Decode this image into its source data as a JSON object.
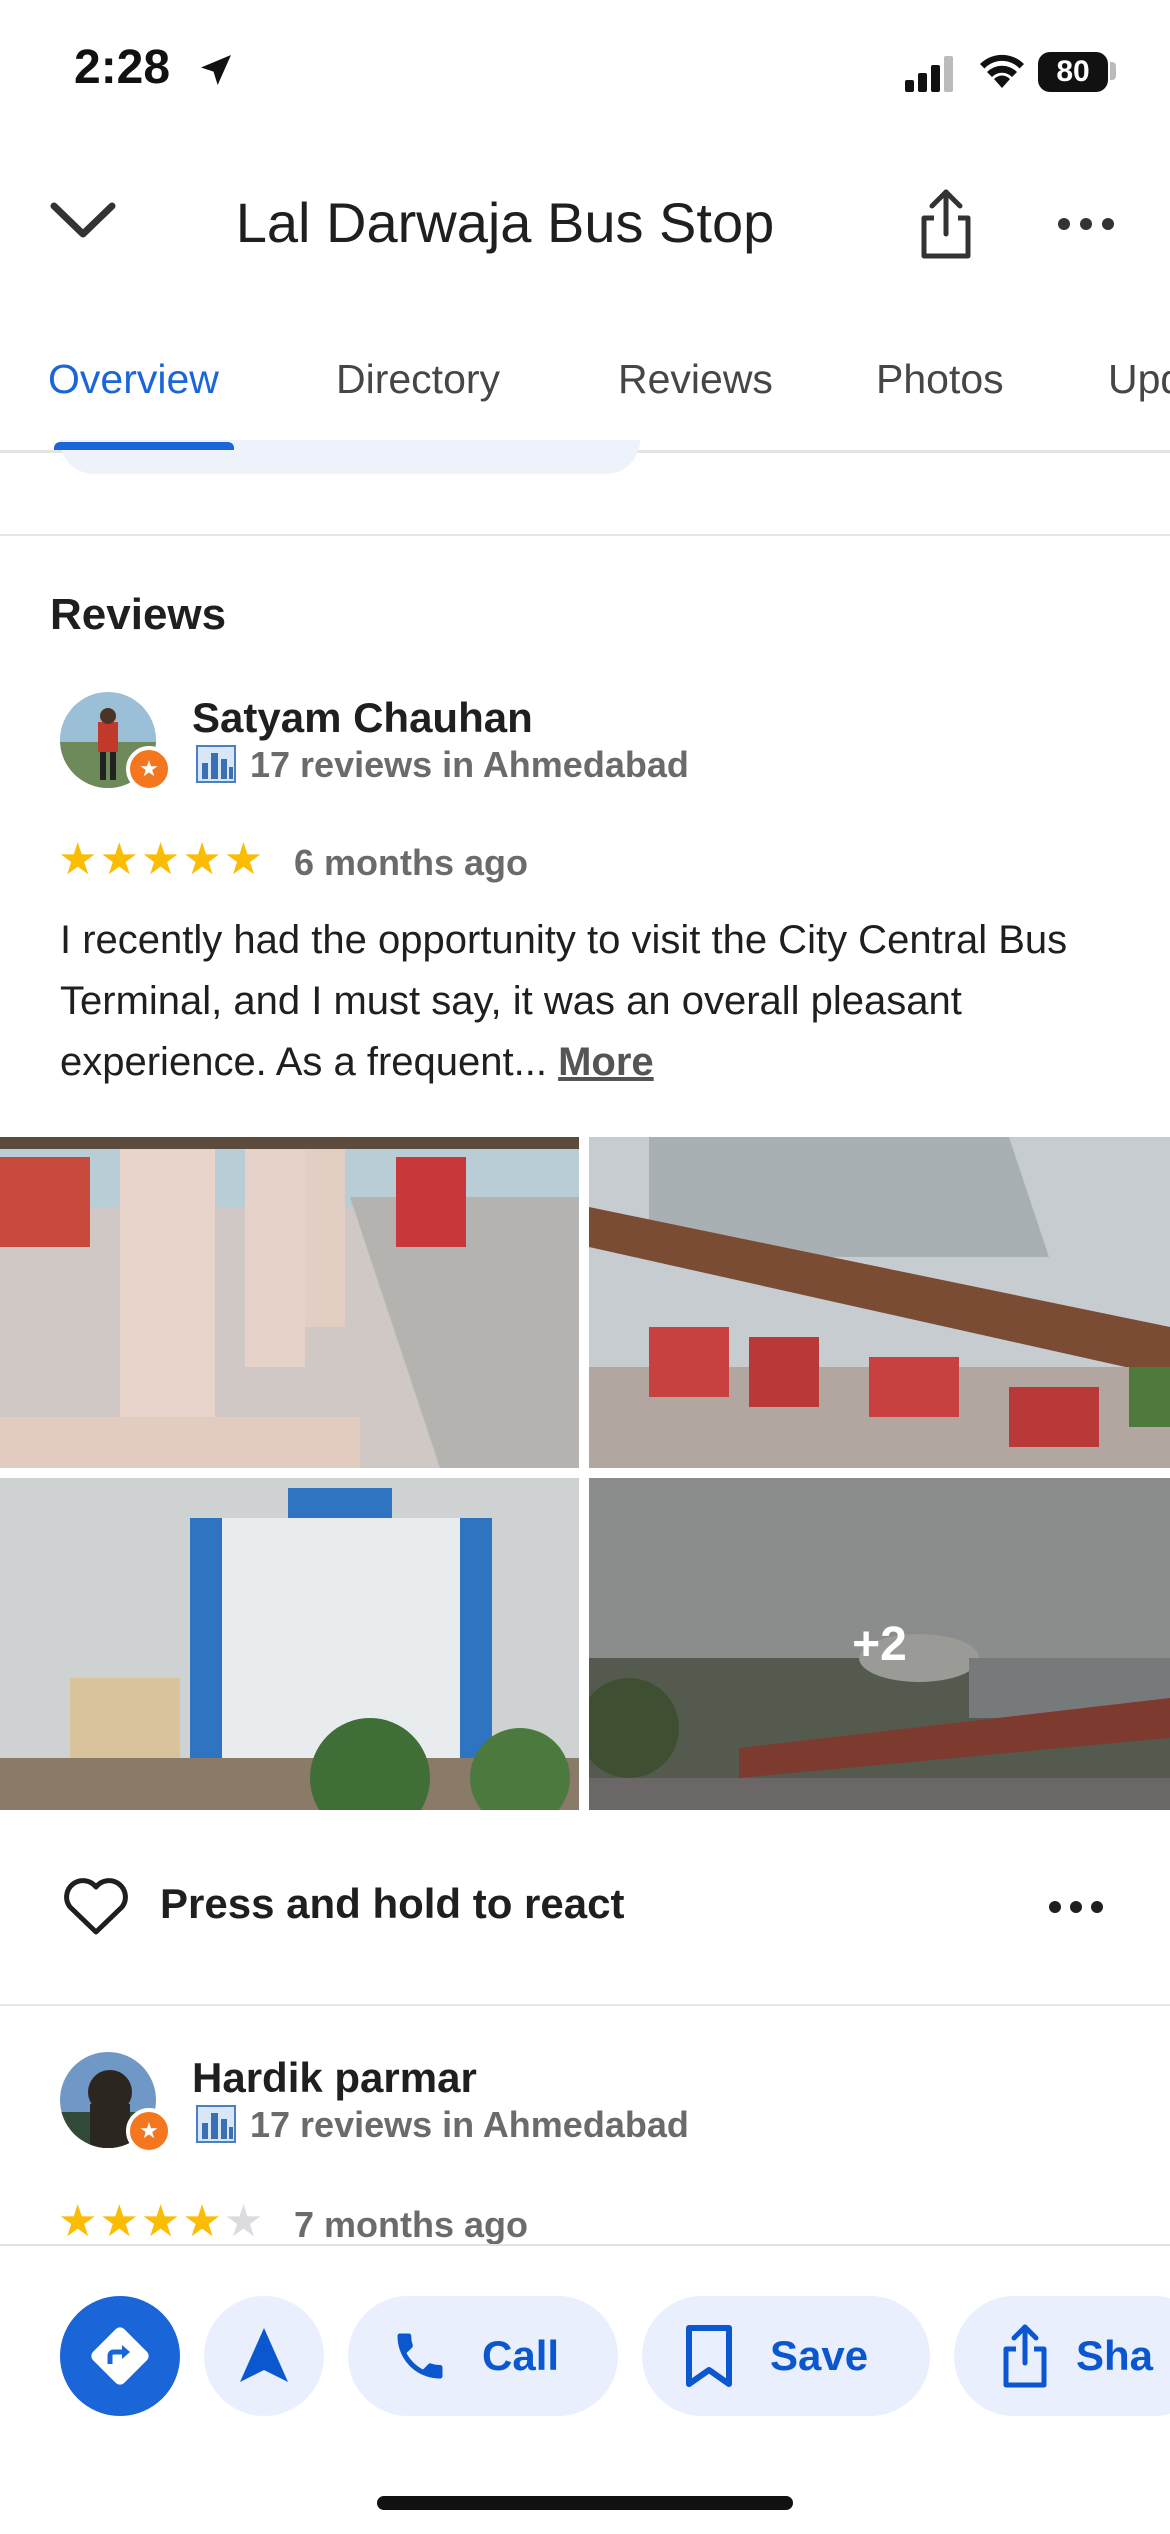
{
  "status_bar": {
    "time": "2:28",
    "battery": "80"
  },
  "header": {
    "title": "Lal Darwaja Bus Stop"
  },
  "tabs": [
    {
      "label": "Overview",
      "active": true
    },
    {
      "label": "Directory"
    },
    {
      "label": "Reviews"
    },
    {
      "label": "Photos"
    },
    {
      "label": "Upd"
    }
  ],
  "reviews_section": {
    "title": "Reviews"
  },
  "reviews": [
    {
      "name": "Satyam Chauhan",
      "meta": "17 reviews in Ahmedabad",
      "rating": 5,
      "stars_text": "★★★★★",
      "time_ago": "6 months ago",
      "text": "I recently had the opportunity to visit the City Central Bus Terminal, and I must say, it was an overall pleasant experience. As a frequent...",
      "more_label": "More",
      "extra_photos_label": "+2",
      "react_label": "Press and hold to react"
    },
    {
      "name": "Hardik parmar",
      "meta": "17 reviews in Ahmedabad",
      "rating": 4,
      "stars_on_text": "★★★★",
      "stars_off_text": "★",
      "time_ago": "7 months ago"
    }
  ],
  "bottom_actions": {
    "call_label": "Call",
    "save_label": "Save",
    "share_label": "Sha"
  },
  "colors": {
    "accent": "#1a66d9",
    "pill_bg": "#e9effc",
    "star": "#fbbc04",
    "badge": "#f4771f"
  }
}
